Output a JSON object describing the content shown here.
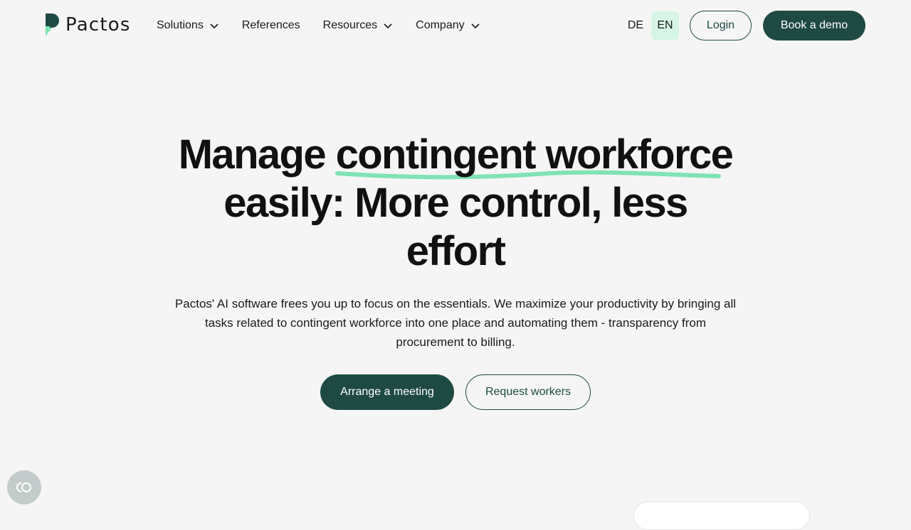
{
  "brand": {
    "name": "Pactos",
    "primary_color": "#1f4a44",
    "accent_color": "#7fe3b4",
    "lang_active_bg": "#d7f5e6"
  },
  "nav": {
    "items": [
      {
        "label": "Solutions",
        "has_dropdown": true
      },
      {
        "label": "References",
        "has_dropdown": false
      },
      {
        "label": "Resources",
        "has_dropdown": true
      },
      {
        "label": "Company",
        "has_dropdown": true
      }
    ]
  },
  "lang": {
    "de": "DE",
    "en": "EN",
    "active": "EN"
  },
  "header_buttons": {
    "login": "Login",
    "demo": "Book a demo"
  },
  "hero": {
    "title_part1": "Manage",
    "title_highlight": "contingent workforce",
    "title_part2": "easily: More control, less effort",
    "subtitle": "Pactos' AI software frees you up to focus on the essentials. We maximize your productivity by bringing all tasks related to contingent workforce into one place and automating them - transparency from procurement to billing.",
    "cta_primary": "Arrange a meeting",
    "cta_secondary": "Request workers"
  },
  "icons": {
    "cookie_widget": "cookie-consent-icon",
    "dropdown": "chevron-down-icon"
  }
}
